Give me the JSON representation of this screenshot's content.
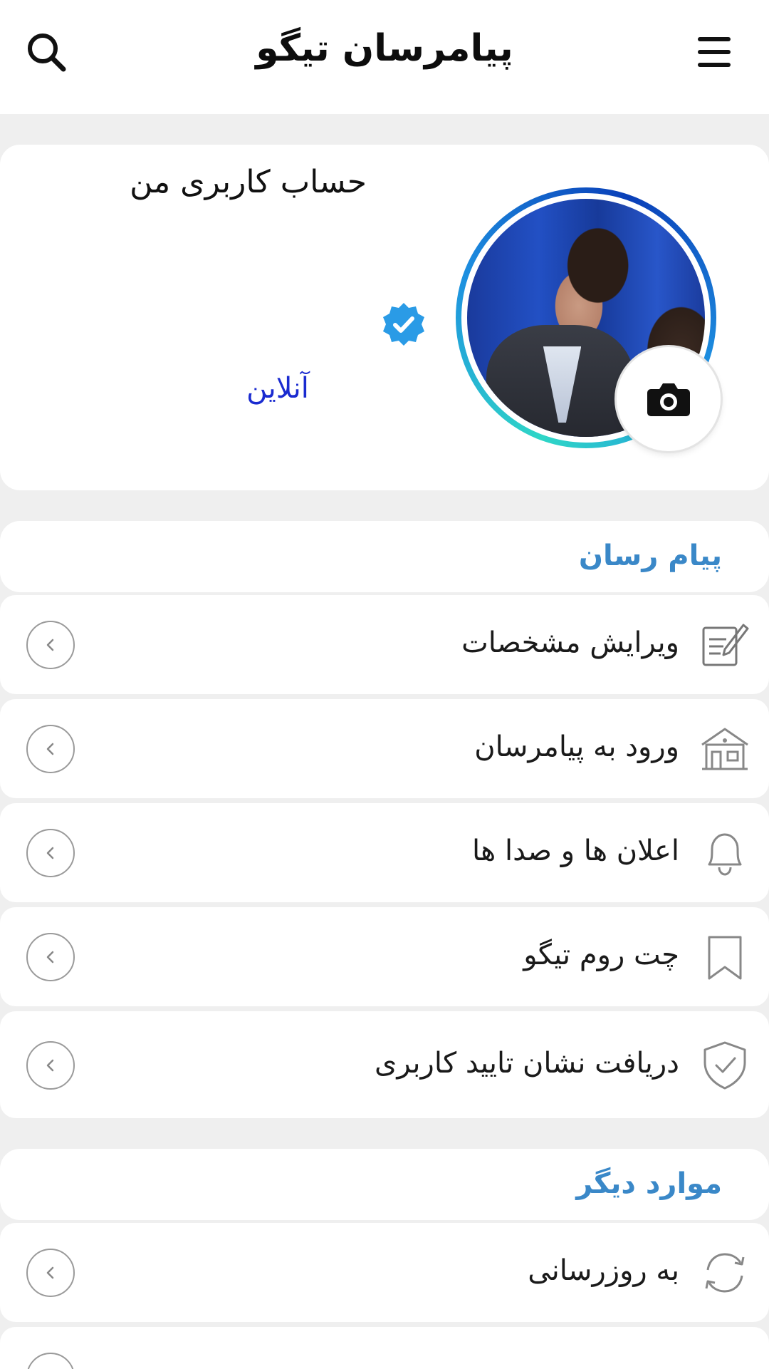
{
  "appbar": {
    "title": "پیامرسان تیگو",
    "menu_icon": "hamburger-menu-icon",
    "search_icon": "search-icon"
  },
  "profile": {
    "name": "حساب کاربری من",
    "status": "آنلاین",
    "verified": true,
    "status_color": "#1a2bd0",
    "badge_color": "#2a9be6"
  },
  "sections": [
    {
      "title": "پیام رسان",
      "items": [
        {
          "label": "ویرایش مشخصات",
          "icon": "edit-note-icon"
        },
        {
          "label": "ورود به پیامرسان",
          "icon": "building-icon"
        },
        {
          "label": "اعلان ها و صدا ها",
          "icon": "bell-icon"
        },
        {
          "label": "چت روم تیگو",
          "icon": "bookmark-icon"
        },
        {
          "label": "دریافت نشان تایید کاربری",
          "icon": "shield-check-icon"
        }
      ]
    },
    {
      "title": "موارد دیگر",
      "items": [
        {
          "label": "به روزرسانی",
          "icon": "refresh-icon"
        }
      ]
    }
  ],
  "theme": {
    "accent": "#3a88c8",
    "background": "#efefef",
    "card": "#ffffff"
  }
}
